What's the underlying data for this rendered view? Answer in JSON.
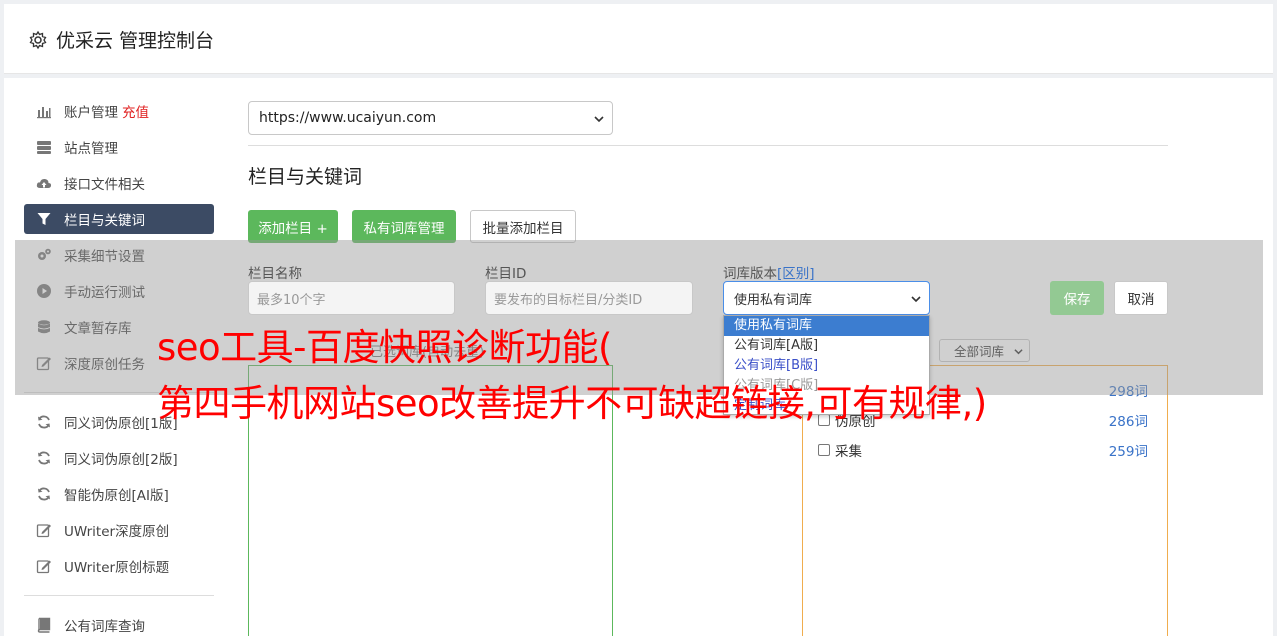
{
  "app": {
    "title": "优采云 管理控制台",
    "icon": "gear-icon"
  },
  "sidebar": {
    "items": [
      {
        "label": "账户管理",
        "extra": "充值",
        "icon": "bar-chart-icon",
        "active": false
      },
      {
        "label": "站点管理",
        "icon": "server-icon",
        "active": false
      },
      {
        "label": "接口文件相关",
        "icon": "cloud-upload-icon",
        "active": false
      },
      {
        "label": "栏目与关键词",
        "icon": "filter-icon",
        "active": true
      },
      {
        "label": "采集细节设置",
        "icon": "cogs-icon",
        "active": false
      },
      {
        "label": "手动运行测试",
        "icon": "play-circle-icon",
        "active": false
      },
      {
        "label": "文章暂存库",
        "icon": "database-icon",
        "active": false
      },
      {
        "label": "深度原创任务",
        "icon": "edit-icon",
        "active": false
      }
    ],
    "items2": [
      {
        "label": "同义词伪原创[1版]",
        "icon": "refresh-icon"
      },
      {
        "label": "同义词伪原创[2版]",
        "icon": "refresh-icon"
      },
      {
        "label": "智能伪原创[AI版]",
        "icon": "refresh-icon"
      },
      {
        "label": "UWriter深度原创",
        "icon": "edit-icon"
      },
      {
        "label": "UWriter原创标题",
        "icon": "edit-icon"
      }
    ],
    "items3": [
      {
        "label": "公有词库查询",
        "icon": "book-icon"
      }
    ]
  },
  "site_select": {
    "value": "https://www.ucaiyun.com"
  },
  "section": {
    "title": "栏目与关键词"
  },
  "buttons": {
    "add_column": "添加栏目 +",
    "private_lib": "私有词库管理",
    "batch_add": "批量添加栏目",
    "save": "保存",
    "cancel": "取消"
  },
  "form": {
    "name_label": "栏目名称",
    "name_placeholder": "最多10个字",
    "id_label": "栏目ID",
    "id_placeholder": "要发布的目标栏目/分类ID",
    "version_label": "词库版本",
    "version_label_link": "[区别]",
    "version_value": "使用私有词库",
    "version_options": [
      "使用私有词库",
      "公有词库[A版]",
      "公有词库[B版]",
      "公有词库[C版]",
      "定制词库"
    ]
  },
  "lists": {
    "left_label": "已选词库(自动去重)",
    "filter_value": "全部词库",
    "right_items": [
      {
        "label": "",
        "count": "298词"
      },
      {
        "label": "伪原创",
        "count": "286词"
      },
      {
        "label": "采集",
        "count": "259词"
      }
    ]
  },
  "watermark": {
    "line1": "seo工具-百度快照诊断功能(",
    "line2": "第四手机网站seo改善提升不可缺超链接,可有规律,)"
  },
  "colors": {
    "sidebar_active": "#3c4b64",
    "green": "#5cb85c",
    "orange_border": "#f0ad4e",
    "link_blue": "#3a73c8",
    "watermark_red": "#ff0000"
  }
}
